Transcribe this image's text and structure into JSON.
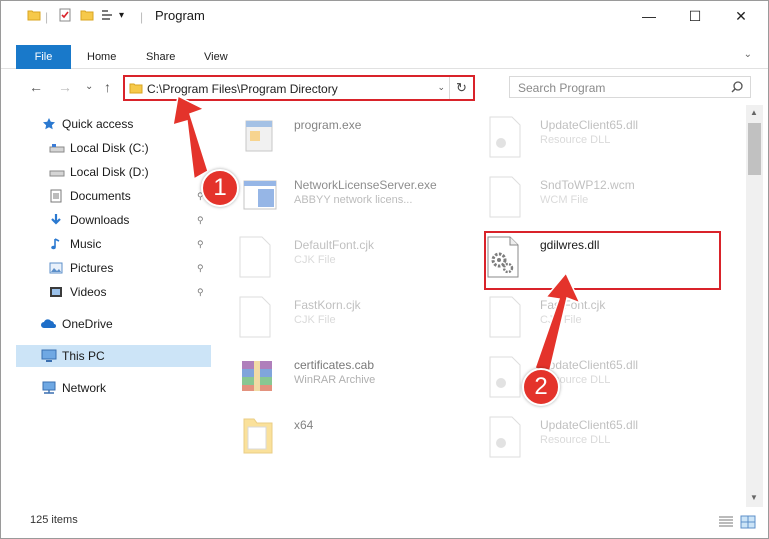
{
  "window": {
    "title": "Program",
    "controls": {
      "minimize": "—",
      "maximize": "☐",
      "close": "✕"
    }
  },
  "ribbon": {
    "tabs": [
      "File",
      "Home",
      "Share",
      "View"
    ],
    "expand_glyph": "⌄"
  },
  "nav": {
    "back": "←",
    "forward": "→",
    "recent": "⌄",
    "up": "↑"
  },
  "address": {
    "path": "C:\\Program Files\\Program Directory",
    "chevron": "⌄",
    "refresh": "↻"
  },
  "search": {
    "placeholder": "Search Program"
  },
  "sidebar": {
    "items": [
      {
        "label": "Quick access",
        "icon": "star-icon"
      },
      {
        "label": "Local Disk (C:)",
        "icon": "drive-icon"
      },
      {
        "label": "Local Disk (D:)",
        "icon": "drive-icon",
        "pinned": true
      },
      {
        "label": "Documents",
        "icon": "documents-icon",
        "pinned": true
      },
      {
        "label": "Downloads",
        "icon": "download-icon",
        "pinned": true
      },
      {
        "label": "Music",
        "icon": "music-icon",
        "pinned": true
      },
      {
        "label": "Pictures",
        "icon": "pictures-icon",
        "pinned": true
      },
      {
        "label": "Videos",
        "icon": "videos-icon",
        "pinned": true
      },
      {
        "label": "OneDrive",
        "icon": "cloud-icon"
      },
      {
        "label": "This PC",
        "icon": "pc-icon",
        "selected": true
      },
      {
        "label": "Network",
        "icon": "network-icon"
      }
    ],
    "pin_glyph": "📌"
  },
  "files": [
    {
      "name": "program.exe",
      "desc": "",
      "icon": "exe-icon"
    },
    {
      "name": "UpdateClient65.dll",
      "desc": "Resource DLL",
      "icon": "dll-icon"
    },
    {
      "name": "NetworkLicenseServer.exe",
      "desc": "ABBYY network licens...",
      "icon": "exe-window-icon"
    },
    {
      "name": "SndToWP12.wcm",
      "desc": "WCM File",
      "icon": "file-icon"
    },
    {
      "name": "DefaultFont.cjk",
      "desc": "CJK File",
      "icon": "file-icon"
    },
    {
      "name": "gdilwres.dll",
      "desc": "",
      "icon": "dll-icon"
    },
    {
      "name": "FastKorn.cjk",
      "desc": "CJK File",
      "icon": "file-icon"
    },
    {
      "name": "FastFont.cjk",
      "desc": "CJK File",
      "icon": "file-icon"
    },
    {
      "name": "certificates.cab",
      "desc": "WinRAR Archive",
      "icon": "archive-icon"
    },
    {
      "name": "UpdateClient65.dll",
      "desc": "Resource DLL",
      "icon": "dll-icon"
    },
    {
      "name": "x64",
      "desc": "",
      "icon": "folder-icon"
    },
    {
      "name": "UpdateClient65.dll",
      "desc": "Resource DLL",
      "icon": "dll-icon"
    }
  ],
  "status": {
    "count": "125 items"
  },
  "annotations": {
    "step1": "1",
    "step2": "2",
    "accent": "#d9232a"
  }
}
